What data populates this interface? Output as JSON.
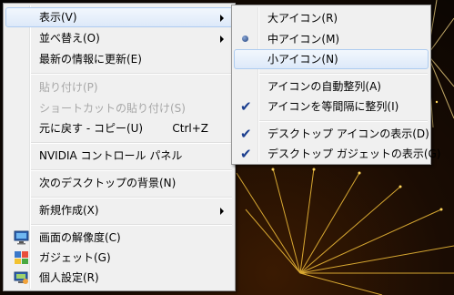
{
  "main_menu": {
    "items": [
      {
        "label": "表示(V)"
      },
      {
        "label": "並べ替え(O)"
      },
      {
        "label": "最新の情報に更新(E)"
      },
      {
        "label": "貼り付け(P)"
      },
      {
        "label": "ショートカットの貼り付け(S)"
      },
      {
        "label": "元に戻す - コピー(U)",
        "shortcut": "Ctrl+Z"
      },
      {
        "label": "NVIDIA コントロール パネル"
      },
      {
        "label": "次のデスクトップの背景(N)"
      },
      {
        "label": "新規作成(X)"
      },
      {
        "label": "画面の解像度(C)",
        "icon": "display-resolution-icon"
      },
      {
        "label": "ガジェット(G)",
        "icon": "gadgets-icon"
      },
      {
        "label": "個人設定(R)",
        "icon": "personalize-icon"
      }
    ]
  },
  "view_submenu": {
    "items": [
      {
        "label": "大アイコン(R)"
      },
      {
        "label": "中アイコン(M)",
        "mark": "radio-selected-icon"
      },
      {
        "label": "小アイコン(N)"
      },
      {
        "label": "アイコンの自動整列(A)"
      },
      {
        "label": "アイコンを等間隔に整列(I)",
        "mark": "checkmark-icon"
      },
      {
        "label": "デスクトップ アイコンの表示(D)",
        "mark": "checkmark-icon"
      },
      {
        "label": "デスクトップ ガジェットの表示(G)",
        "mark": "checkmark-icon"
      }
    ]
  },
  "colors": {
    "menu_background": "#f0f0f0",
    "highlight_border": "#aeccf0",
    "disabled_text": "#a7a7a7"
  }
}
